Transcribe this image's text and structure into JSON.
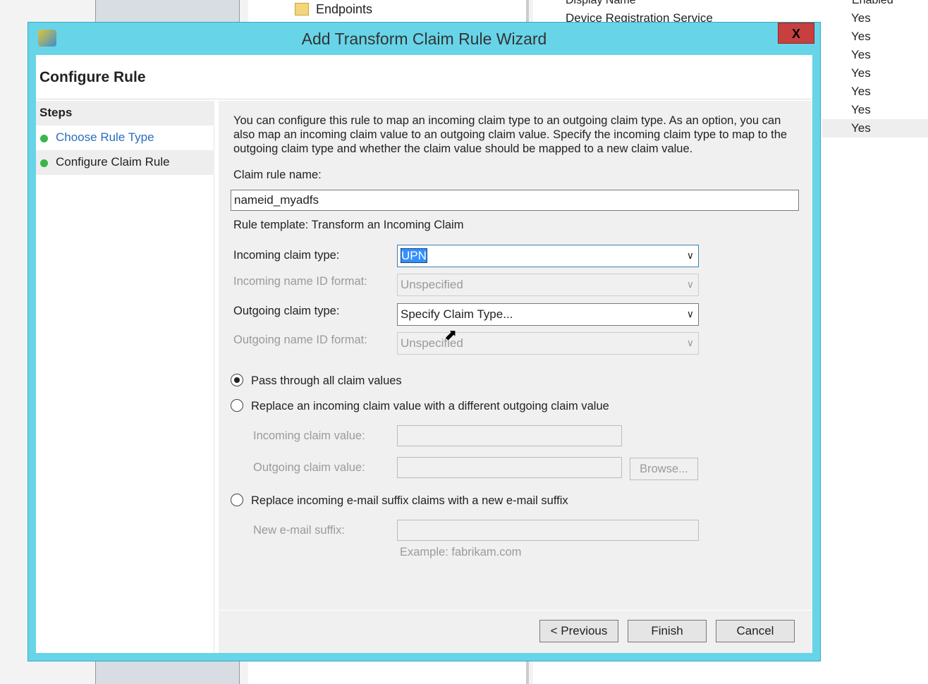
{
  "background": {
    "tree_item": "Endpoints",
    "list_headers": [
      "Display Name",
      "Enabled"
    ],
    "first_row_name": "Device Registration Service",
    "enabled_values": [
      "Yes",
      "Yes",
      "Yes",
      "Yes",
      "Yes",
      "Yes",
      "Yes"
    ]
  },
  "window": {
    "title": "Add Transform Claim Rule Wizard",
    "close_label": "X"
  },
  "page_title": "Configure Rule",
  "steps": {
    "heading": "Steps",
    "items": [
      {
        "label": "Choose Rule Type",
        "link": true
      },
      {
        "label": "Configure Claim Rule",
        "link": false
      }
    ]
  },
  "form": {
    "description": "You can configure this rule to map an incoming claim type to an outgoing claim type. As an option, you can also map an incoming claim value to an outgoing claim value. Specify the incoming claim type to map to the outgoing claim type and whether the claim value should be mapped to a new claim value.",
    "rule_name_label": "Claim rule name:",
    "rule_name_value": "nameid_myadfs",
    "template": "Rule template: Transform an Incoming Claim",
    "incoming_type_label": "Incoming claim type:",
    "incoming_type_value": "UPN",
    "incoming_nameid_label": "Incoming name ID format:",
    "incoming_nameid_value": "Unspecified",
    "outgoing_type_label": "Outgoing claim type:",
    "outgoing_type_value": "Specify Claim Type...",
    "outgoing_nameid_label": "Outgoing name ID format:",
    "outgoing_nameid_value": "Unspecified",
    "radio_pass": "Pass through all claim values",
    "radio_replace": "Replace an incoming claim value with a different outgoing claim value",
    "incoming_value_label": "Incoming claim value:",
    "outgoing_value_label": "Outgoing claim value:",
    "browse": "Browse...",
    "radio_email": "Replace incoming e-mail suffix claims with a new e-mail suffix",
    "email_label": "New e-mail suffix:",
    "email_example": "Example: fabrikam.com",
    "selected_radio": "pass"
  },
  "buttons": {
    "previous": "< Previous",
    "finish": "Finish",
    "cancel": "Cancel"
  }
}
